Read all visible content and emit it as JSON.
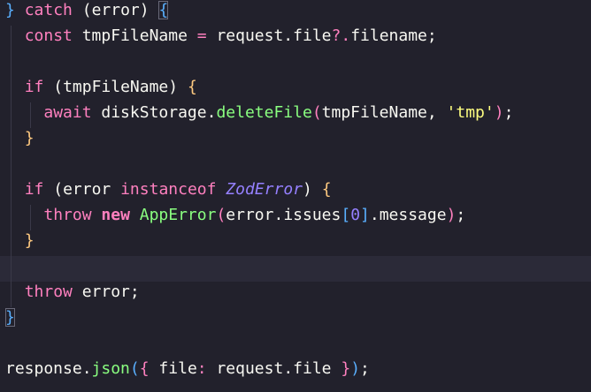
{
  "code": {
    "l1": {
      "brace_close": "}",
      "catch": "catch",
      "paren_open": " (",
      "var": "error",
      "paren_close": ")",
      "space": " ",
      "brace_open": "{"
    },
    "l2": {
      "const": "const",
      "name": " tmpFileName ",
      "eq": "=",
      "rest": " request.file",
      "opt": "?.",
      "tail": "filename;"
    },
    "l4": {
      "if": "if",
      "paren_open": " (",
      "cond": "tmpFileName",
      "paren_close": ")",
      "space": " ",
      "brace": "{"
    },
    "l5": {
      "await": "await",
      "obj": " diskStorage.",
      "fn": "deleteFile",
      "paren_open": "(",
      "arg": "tmpFileName, ",
      "str": "'tmp'",
      "paren_close": ")",
      "semi": ";"
    },
    "l6": {
      "brace": "}"
    },
    "l8": {
      "if": "if",
      "paren_open": " (",
      "lhs": "error ",
      "instanceof": "instanceof",
      "space1": " ",
      "type": "ZodError",
      "paren_close": ")",
      "space": " ",
      "brace": "{"
    },
    "l9": {
      "throw": "throw",
      "space1": " ",
      "new": "new",
      "space2": " ",
      "cls": "AppError",
      "paren_open": "(",
      "obj": "error.issues",
      "bracket_open": "[",
      "num": "0",
      "bracket_close": "]",
      "rest": ".message",
      "paren_close": ")",
      "semi": ";"
    },
    "l10": {
      "brace": "}"
    },
    "l12": {
      "throw": "throw",
      "rest": " error;"
    },
    "l13": {
      "brace": "}"
    },
    "l15": {
      "obj": "response.",
      "fn": "json",
      "paren_open": "(",
      "brace_open": "{",
      "key": " file",
      "colon": ":",
      "val": " request.file ",
      "brace_close": "}",
      "paren_close": ")",
      "semi": ";"
    }
  },
  "colors": {
    "background": "#22212c",
    "keyword": "#ff80bf",
    "function": "#8aff80",
    "type": "#9580ff",
    "string": "#ffff80",
    "text": "#f8f8f2"
  }
}
